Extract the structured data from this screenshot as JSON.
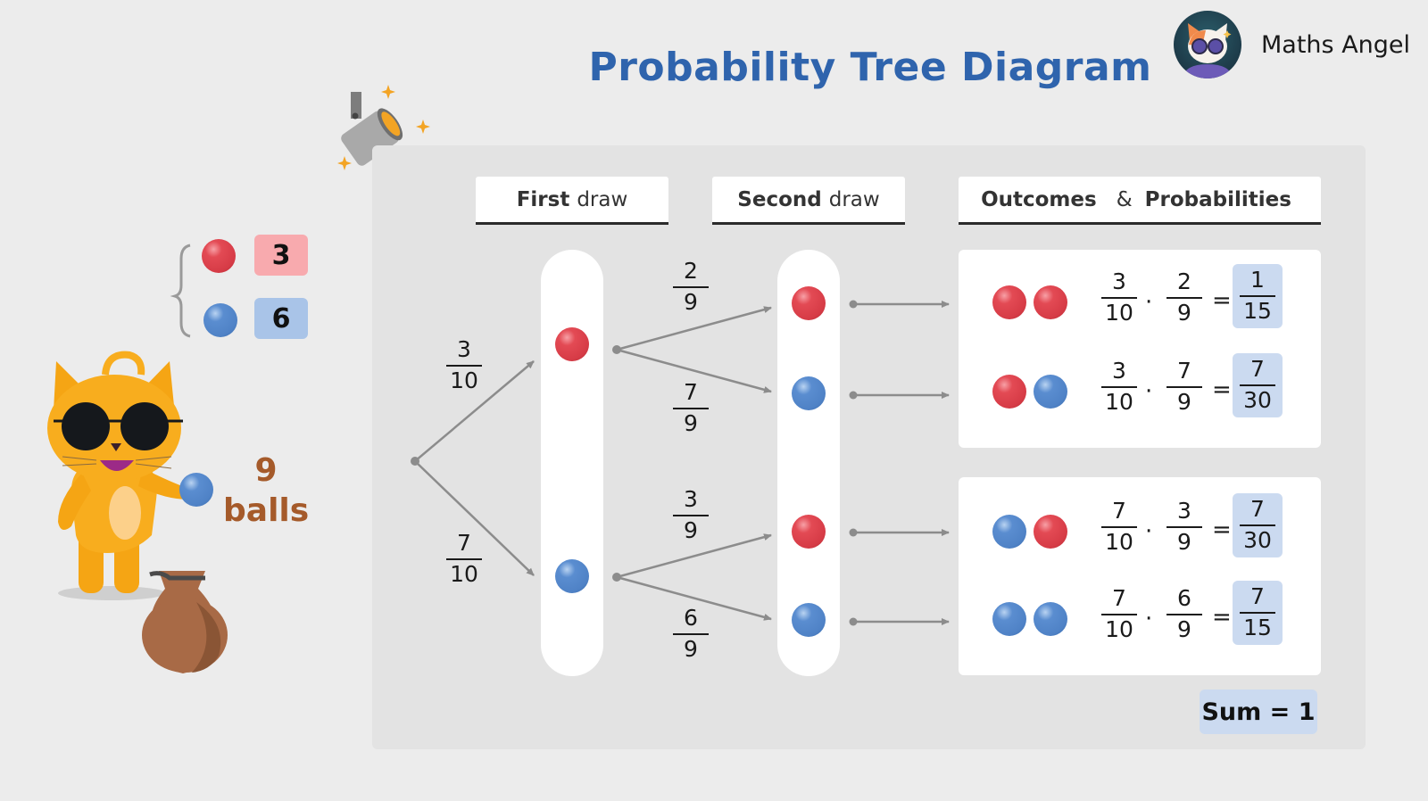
{
  "title": "Probability Tree Diagram",
  "brand": {
    "name": "Maths Angel",
    "logo_icon": "cat-with-sunglasses-logo"
  },
  "colors": {
    "accent": "#2f64ad",
    "red_ball": "#d63b46",
    "blue_ball": "#4f82c6",
    "result_bg": "#cbdaf0",
    "red_count_bg": "#f8aaae",
    "blue_count_bg": "#a9c4e8",
    "balls_label": "#a55a2a"
  },
  "legend": {
    "items": [
      {
        "color": "red",
        "count": "3"
      },
      {
        "color": "blue",
        "count": "6"
      }
    ],
    "total_number": "9",
    "total_unit": "balls"
  },
  "headers": {
    "first": {
      "bold": "First",
      "rest": "draw"
    },
    "second": {
      "bold": "Second",
      "rest": "draw"
    },
    "outcomes": {
      "bold1": "Outcomes",
      "amp": "&",
      "bold2": "Probabilities"
    }
  },
  "tree": {
    "first_draw": [
      {
        "color": "red",
        "prob": {
          "num": "3",
          "den": "10"
        }
      },
      {
        "color": "blue",
        "prob": {
          "num": "7",
          "den": "10"
        }
      }
    ],
    "second_draw": [
      {
        "color": "red",
        "prob": {
          "num": "2",
          "den": "9"
        }
      },
      {
        "color": "blue",
        "prob": {
          "num": "7",
          "den": "9"
        }
      },
      {
        "color": "red",
        "prob": {
          "num": "3",
          "den": "9"
        }
      },
      {
        "color": "blue",
        "prob": {
          "num": "6",
          "den": "9"
        }
      }
    ]
  },
  "outcomes": [
    {
      "balls": [
        "red",
        "red"
      ],
      "a": {
        "num": "3",
        "den": "10"
      },
      "b": {
        "num": "2",
        "den": "9"
      },
      "result": {
        "num": "1",
        "den": "15"
      }
    },
    {
      "balls": [
        "red",
        "blue"
      ],
      "a": {
        "num": "3",
        "den": "10"
      },
      "b": {
        "num": "7",
        "den": "9"
      },
      "result": {
        "num": "7",
        "den": "30"
      }
    },
    {
      "balls": [
        "blue",
        "red"
      ],
      "a": {
        "num": "7",
        "den": "10"
      },
      "b": {
        "num": "3",
        "den": "9"
      },
      "result": {
        "num": "7",
        "den": "30"
      }
    },
    {
      "balls": [
        "blue",
        "blue"
      ],
      "a": {
        "num": "7",
        "den": "10"
      },
      "b": {
        "num": "6",
        "den": "9"
      },
      "result": {
        "num": "7",
        "den": "15"
      }
    }
  ],
  "operators": {
    "times": "·",
    "equals": "="
  },
  "sum_label": "Sum = 1"
}
